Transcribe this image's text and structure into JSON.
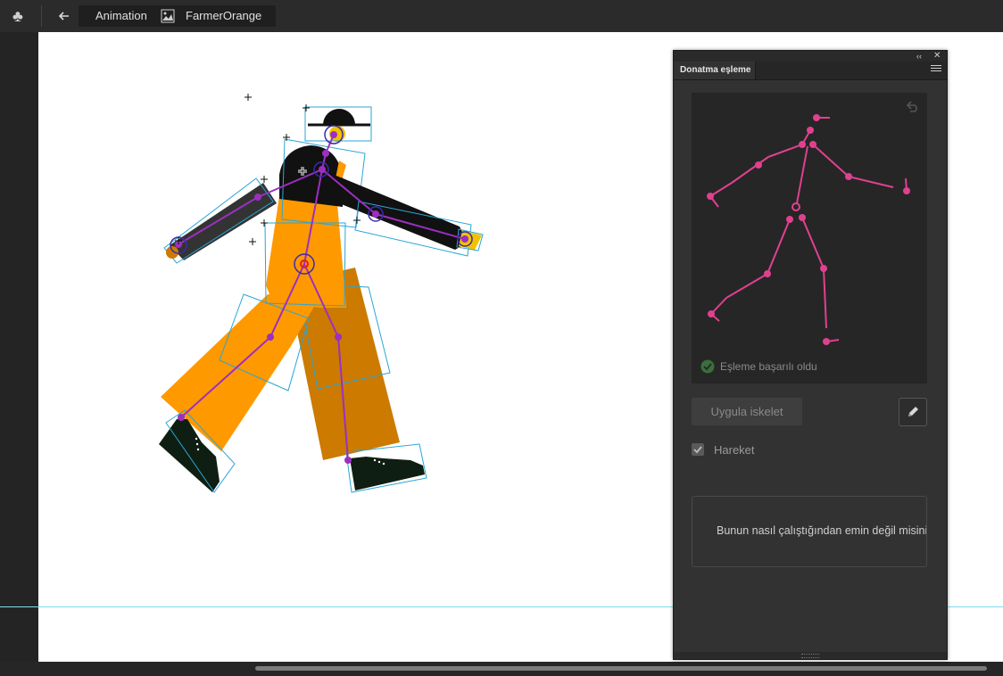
{
  "topbar": {
    "app_icon": "clubs-icon",
    "back_icon": "arrow-left-icon",
    "scene_label": "Animation",
    "symbol_icon": "graphic-symbol-icon",
    "symbol_label": "FarmerOrange"
  },
  "stage": {
    "background": "#ffffff",
    "character": {
      "name": "FarmerOrange",
      "colors": {
        "body": "#ff9900",
        "back_leg": "#cc7a00",
        "dark": "#111111",
        "shoe": "#0f1e12",
        "bone": "#9b30c0",
        "bounds": "#2aa6d6",
        "hand": "#f2c100"
      }
    }
  },
  "panel": {
    "tab_label": "Donatma eşleme",
    "collapse_icon": "double-chevron-left-icon",
    "close_icon": "close-icon",
    "menu_icon": "hamburger-menu-icon",
    "reset_icon": "undo-icon",
    "rig_map_color": "#e0418f",
    "status_icon": "check-circle-icon",
    "status_text": "Eşleme başarılı oldu",
    "apply_label": "Uygula iskelet",
    "edit_icon": "pencil-icon",
    "motion_label": "Hareket",
    "motion_checked": true,
    "help_text": "Bunun nasıl çalıştığından emin değil misiniz?"
  }
}
